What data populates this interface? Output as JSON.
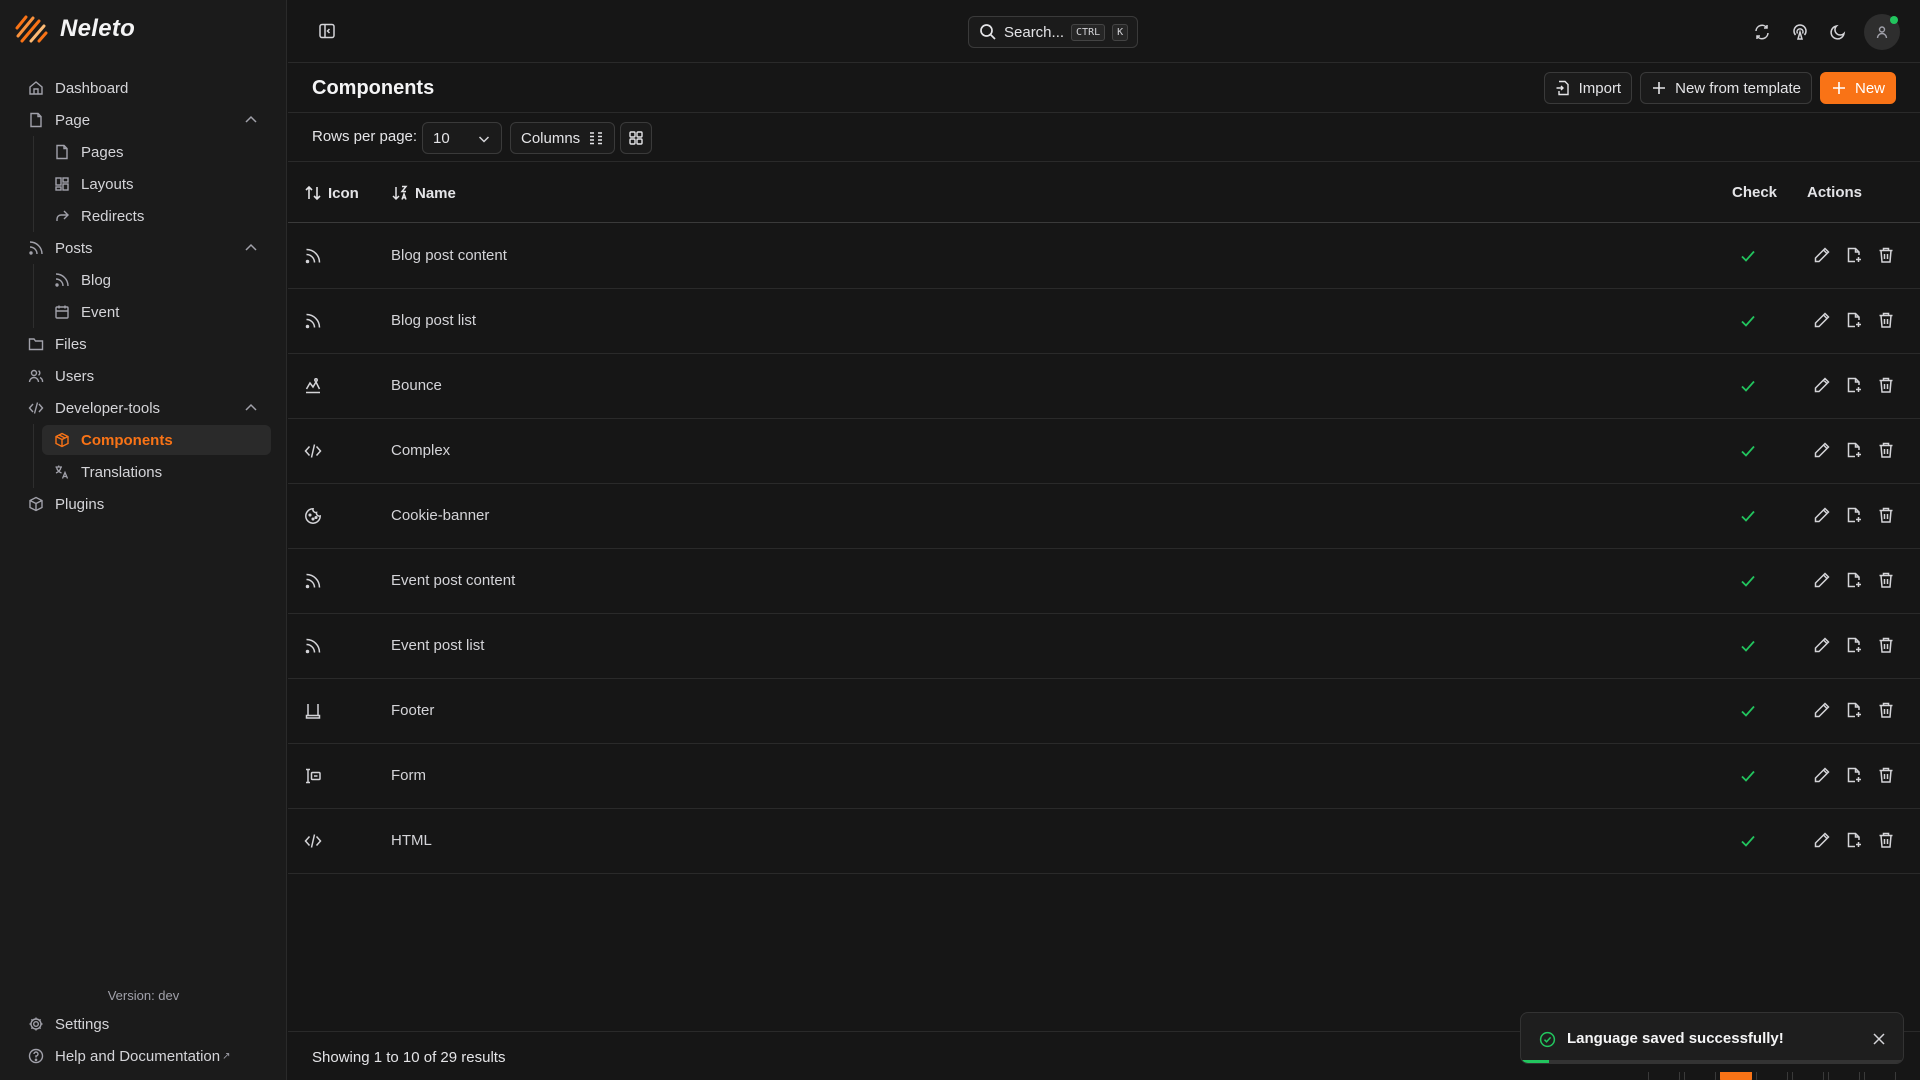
{
  "brand": {
    "name": "Neleto"
  },
  "sidebar": {
    "items": [
      {
        "label": "Dashboard"
      },
      {
        "label": "Page"
      },
      {
        "label": "Pages"
      },
      {
        "label": "Layouts"
      },
      {
        "label": "Redirects"
      },
      {
        "label": "Posts"
      },
      {
        "label": "Blog"
      },
      {
        "label": "Event"
      },
      {
        "label": "Files"
      },
      {
        "label": "Users"
      },
      {
        "label": "Developer-tools"
      },
      {
        "label": "Components"
      },
      {
        "label": "Translations"
      },
      {
        "label": "Plugins"
      }
    ],
    "version": "Version: dev",
    "settings": "Settings",
    "help": "Help and Documentation",
    "help_ext": "↗"
  },
  "topbar": {
    "search_label": "Search...",
    "kbd_ctrl": "CTRL",
    "kbd_k": "K"
  },
  "header": {
    "title": "Components",
    "import_label": "Import",
    "template_label": "New from template",
    "new_label": "New"
  },
  "toolbar": {
    "rows_label": "Rows per page:",
    "rows_value": "10",
    "columns_label": "Columns"
  },
  "table": {
    "headers": {
      "icon": "Icon",
      "name": "Name",
      "check": "Check",
      "actions": "Actions"
    },
    "rows": [
      {
        "name": "Blog post content",
        "icon": "rss-icon"
      },
      {
        "name": "Blog post list",
        "icon": "rss-icon"
      },
      {
        "name": "Bounce",
        "icon": "bounce-icon"
      },
      {
        "name": "Complex",
        "icon": "code-icon"
      },
      {
        "name": "Cookie-banner",
        "icon": "cookie-icon"
      },
      {
        "name": "Event post content",
        "icon": "rss-icon"
      },
      {
        "name": "Event post list",
        "icon": "rss-icon"
      },
      {
        "name": "Footer",
        "icon": "footer-icon"
      },
      {
        "name": "Form",
        "icon": "form-icon"
      },
      {
        "name": "HTML",
        "icon": "code-icon"
      }
    ]
  },
  "footer": {
    "showing": "Showing 1 to 10 of 29 results"
  },
  "toast": {
    "message": "Language saved successfully!"
  },
  "colors": {
    "accent": "#f97316",
    "success": "#22c55e",
    "background": "#161616"
  }
}
